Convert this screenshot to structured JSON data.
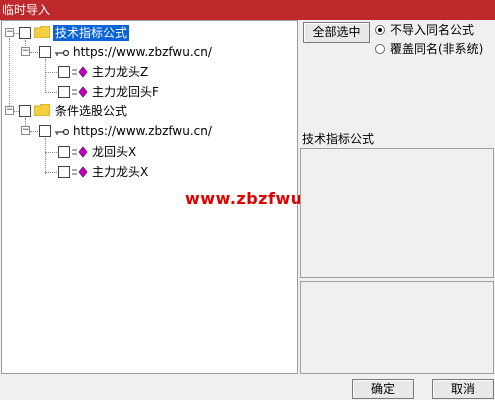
{
  "window": {
    "title": "临时导入"
  },
  "tree": {
    "root1": {
      "label": "技术指标公式",
      "url_label": "https://www.zbzfwu.cn/",
      "items": [
        "主力龙头Z",
        "主力龙回头F"
      ]
    },
    "root2": {
      "label": "条件选股公式",
      "url_label": "https://www.zbzfwu.cn/",
      "items": [
        "龙回头X",
        "主力龙头X"
      ]
    }
  },
  "watermark": "www.zbzfwu.com",
  "options": {
    "select_all_label": "全部选中",
    "radio_skip_label": "不导入同名公式",
    "radio_overwrite_label": "覆盖同名(非系统)",
    "selected": "radio_skip"
  },
  "detail": {
    "label": "技术指标公式"
  },
  "footer": {
    "ok_label": "确定",
    "cancel_label": "取消"
  },
  "colors": {
    "title_bar": "#c0292b",
    "selection": "#0a64d6",
    "watermark": "#e00000"
  }
}
